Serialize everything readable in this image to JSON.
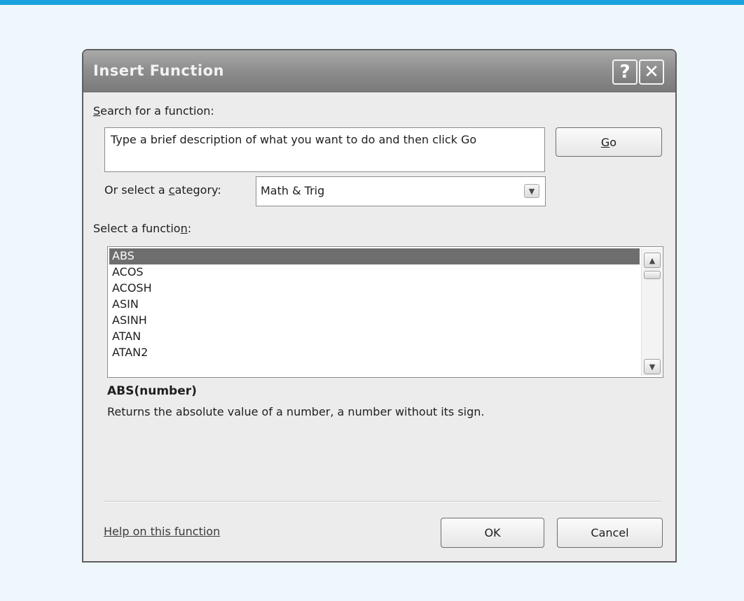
{
  "dialog": {
    "title": "Insert Function",
    "help_button": "?",
    "close_button": "✕",
    "search_label_prefix": "",
    "search_label_underlined": "S",
    "search_label_rest": "earch for a function:",
    "search_box_text": "Type a brief description of what you want to do and then click Go",
    "go_button_prefix": "",
    "go_button_underlined": "G",
    "go_button_rest": "o",
    "category_label_prefix": "Or select a ",
    "category_label_underlined": "c",
    "category_label_rest": "ategory:",
    "category_value": "Math & Trig",
    "dropdown_arrow": "▼",
    "function_label_prefix": "Select a functio",
    "function_label_underlined": "n",
    "function_label_rest": ":",
    "functions": [
      "ABS",
      "ACOS",
      "ACOSH",
      "ASIN",
      "ASINH",
      "ATAN",
      "ATAN2"
    ],
    "selected_function": "ABS",
    "scroll_up": "▲",
    "scroll_down": "▼",
    "function_signature": "ABS(number)",
    "function_description": "Returns the absolute value of a number, a number without its sign.",
    "help_link": "Help on this function",
    "ok_button": "OK",
    "cancel_button": "Cancel"
  },
  "colors": {
    "accent_rule": "#1aa3de",
    "page_background": "#eef7fc",
    "titlebar": "#8f8f8f",
    "selection": "#6e6e6e"
  }
}
